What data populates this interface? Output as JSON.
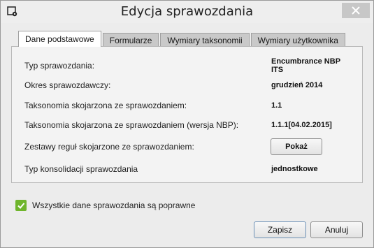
{
  "window": {
    "title": "Edycja sprawozdania"
  },
  "tabs": [
    {
      "label": "Dane podstawowe",
      "active": true
    },
    {
      "label": "Formularze",
      "active": false
    },
    {
      "label": "Wymiary taksonomii",
      "active": false
    },
    {
      "label": "Wymiary użytkownika",
      "active": false
    }
  ],
  "fields": {
    "report_type": {
      "label": "Typ sprawozdania:",
      "value": "Encumbrance NBP ITS"
    },
    "period": {
      "label": "Okres sprawozdawczy:",
      "value": "grudzień 2014"
    },
    "taxonomy": {
      "label": "Taksonomia skojarzona ze sprawozdaniem:",
      "value": "1.1"
    },
    "taxonomy_nbp": {
      "label": "Taksonomia skojarzona ze sprawozdaniem (wersja NBP):",
      "value": "1.1.1[04.02.2015]"
    },
    "rule_sets": {
      "label": "Zestawy reguł skojarzone ze sprawozdaniem:",
      "button": "Pokaż"
    },
    "consolidation": {
      "label": "Typ konsolidacji sprawozdania",
      "value": "jednostkowe"
    }
  },
  "checkbox": {
    "label": "Wszystkie dane sprawozdania są poprawne",
    "checked": true,
    "color": "#6fb52c"
  },
  "buttons": {
    "save": "Zapisz",
    "cancel": "Anuluj"
  },
  "icons": {
    "app": "settings-gear-icon",
    "close": "close-icon",
    "check": "checkmark-icon"
  }
}
